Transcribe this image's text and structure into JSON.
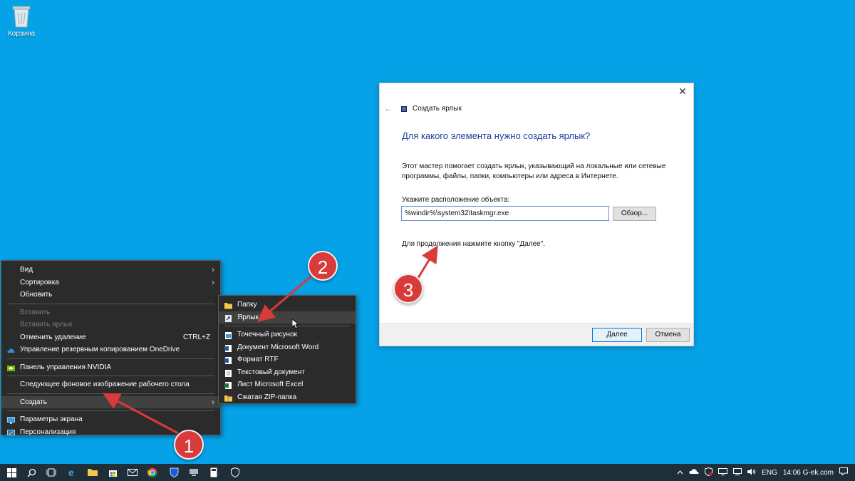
{
  "desktop": {
    "recycle_bin_label": "Корзина",
    "background_color": "#06a2e8"
  },
  "context_menu": {
    "items": [
      {
        "label": "Вид",
        "has_submenu": true
      },
      {
        "label": "Сортировка",
        "has_submenu": true
      },
      {
        "label": "Обновить"
      },
      {
        "label": "Вставить",
        "disabled": true
      },
      {
        "label": "Вставить ярлык",
        "disabled": true
      },
      {
        "label": "Отменить удаление",
        "shortcut": "CTRL+Z"
      },
      {
        "label": "Управление резервным копированием OneDrive",
        "icon": "onedrive-icon"
      },
      {
        "label": "Панель управления NVIDIA",
        "icon": "nvidia-icon"
      },
      {
        "label": "Следующее фоновое изображение рабочего стола"
      },
      {
        "label": "Создать",
        "has_submenu": true,
        "highlighted": true
      },
      {
        "label": "Параметры экрана",
        "icon": "display-settings-icon"
      },
      {
        "label": "Персонализация",
        "icon": "personalization-icon"
      }
    ]
  },
  "submenu": {
    "items": [
      {
        "label": "Папку",
        "icon": "folder-icon"
      },
      {
        "label": "Ярлык",
        "icon": "shortcut-icon",
        "highlighted": true
      },
      {
        "label": "Точечный рисунок",
        "icon": "bitmap-icon"
      },
      {
        "label": "Документ Microsoft Word",
        "icon": "word-icon"
      },
      {
        "label": "Формат RTF",
        "icon": "rtf-icon"
      },
      {
        "label": "Текстовый документ",
        "icon": "text-document-icon"
      },
      {
        "label": "Лист Microsoft Excel",
        "icon": "excel-icon"
      },
      {
        "label": "Сжатая ZIP-папка",
        "icon": "zip-folder-icon"
      }
    ]
  },
  "dialog": {
    "title": "Создать ярлык",
    "heading": "Для какого элемента нужно создать ярлык?",
    "description": "Этот мастер помогает создать ярлык, указывающий на локальные или сетевые программы, файлы, папки, компьютеры или адреса в Интернете.",
    "location_label": "Укажите расположение объекта:",
    "location_value": "%windir%\\system32\\taskmgr.exe",
    "browse_label": "Обзор...",
    "hint": "Для продолжения нажмите кнопку \"Далее\".",
    "next_label": "Далее",
    "cancel_label": "Отмена",
    "close_symbol": "✕",
    "back_symbol": "←"
  },
  "annotations": {
    "step1": "1",
    "step2": "2",
    "step3": "3",
    "color": "#d93a3a"
  },
  "taskbar": {
    "language": "ENG",
    "clock": "14:06 G-ek.com"
  }
}
